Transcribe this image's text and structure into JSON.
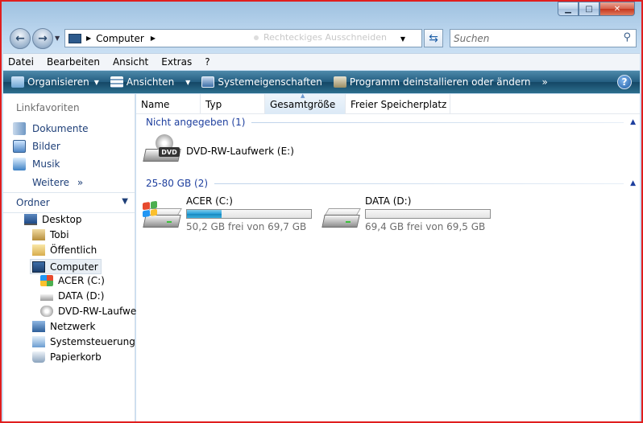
{
  "window": {
    "caption_buttons": {
      "minimize": "▁",
      "maximize": "□",
      "close": "✕"
    }
  },
  "addressbar": {
    "location": "Computer",
    "ghost_text": "Rechteckiges Ausschneiden",
    "search_placeholder": "Suchen"
  },
  "menu": [
    "Datei",
    "Bearbeiten",
    "Ansicht",
    "Extras",
    "?"
  ],
  "commands": {
    "organize": "Organisieren",
    "views": "Ansichten",
    "system_properties": "Systemeigenschaften",
    "uninstall": "Programm deinstallieren oder ändern",
    "more": "»",
    "help": "?"
  },
  "navpane": {
    "favorites_title": "Linkfavoriten",
    "favorites": [
      "Dokumente",
      "Bilder",
      "Musik"
    ],
    "more_label": "Weitere",
    "more_chevron": "»",
    "folders_title": "Ordner",
    "tree": [
      "Desktop",
      "Tobi",
      "Öffentlich",
      "Computer",
      "ACER (C:)",
      "DATA (D:)",
      "DVD-RW-Laufwer",
      "Netzwerk",
      "Systemsteuerung",
      "Papierkorb"
    ]
  },
  "columns": [
    "Name",
    "Typ",
    "Gesamtgröße",
    "Freier Speicherplatz"
  ],
  "groups": {
    "unspecified": "Nicht angegeben (1)",
    "size_range": "25-80 GB (2)"
  },
  "drives": {
    "dvd": {
      "name": "DVD-RW-Laufwerk (E:)",
      "badge": "DVD"
    },
    "acer": {
      "name": "ACER (C:)",
      "free_text": "50,2 GB frei von 69,7 GB",
      "used_fraction": 0.28
    },
    "data": {
      "name": "DATA (D:)",
      "free_text": "69,4 GB frei von 69,5 GB",
      "used_fraction": 0.0
    }
  },
  "colors": {
    "accent": "#1e3f9e",
    "capacity_bar": "#26a0da",
    "window_border": "#e01e1e"
  }
}
